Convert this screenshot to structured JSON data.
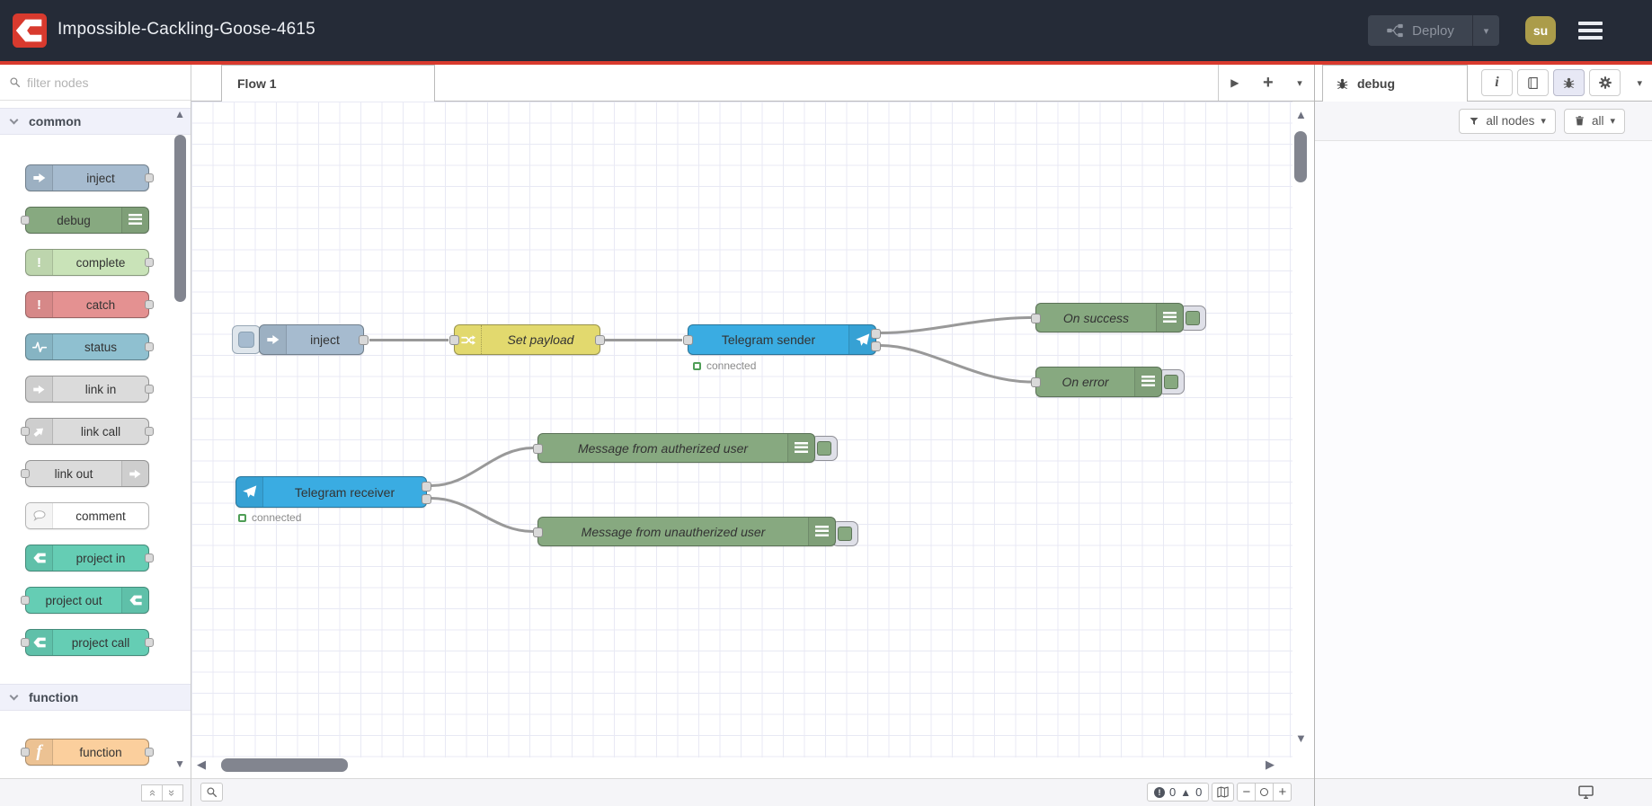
{
  "header": {
    "title": "Impossible-Cackling-Goose-4615",
    "deploy": {
      "label": "Deploy"
    },
    "user_initials": "su"
  },
  "palette": {
    "search_placeholder": "filter nodes",
    "categories": [
      {
        "label": "common",
        "items": [
          "inject",
          "debug",
          "complete",
          "catch",
          "status",
          "link in",
          "link call",
          "link out",
          "comment",
          "project in",
          "project out",
          "project call"
        ]
      },
      {
        "label": "function",
        "items": [
          "function"
        ]
      }
    ]
  },
  "workspace": {
    "tabs": [
      "Flow 1"
    ],
    "nodes": {
      "inject": {
        "label": "inject"
      },
      "set_payload": {
        "label": "Set payload"
      },
      "telegram_sender": {
        "label": "Telegram sender",
        "status": "connected"
      },
      "on_success": {
        "label": "On success"
      },
      "on_error": {
        "label": "On error"
      },
      "telegram_receiver": {
        "label": "Telegram receiver",
        "status": "connected"
      },
      "msg_authorized": {
        "label": "Message from autherized user"
      },
      "msg_unauthorized": {
        "label": "Message from unautherized user"
      }
    },
    "status_bar": {
      "errors": "0",
      "warnings": "0"
    }
  },
  "sidebar": {
    "tab_label": "debug",
    "filter_button": "all nodes",
    "clear_button": "all"
  },
  "colors": {
    "accent_red": "#d83a2e",
    "header_bg": "#252b37",
    "telegram_blue": "#3aace2",
    "debug_green": "#87a980",
    "inject_blue": "#a6bbcf",
    "change_yellow": "#e2d96e"
  }
}
